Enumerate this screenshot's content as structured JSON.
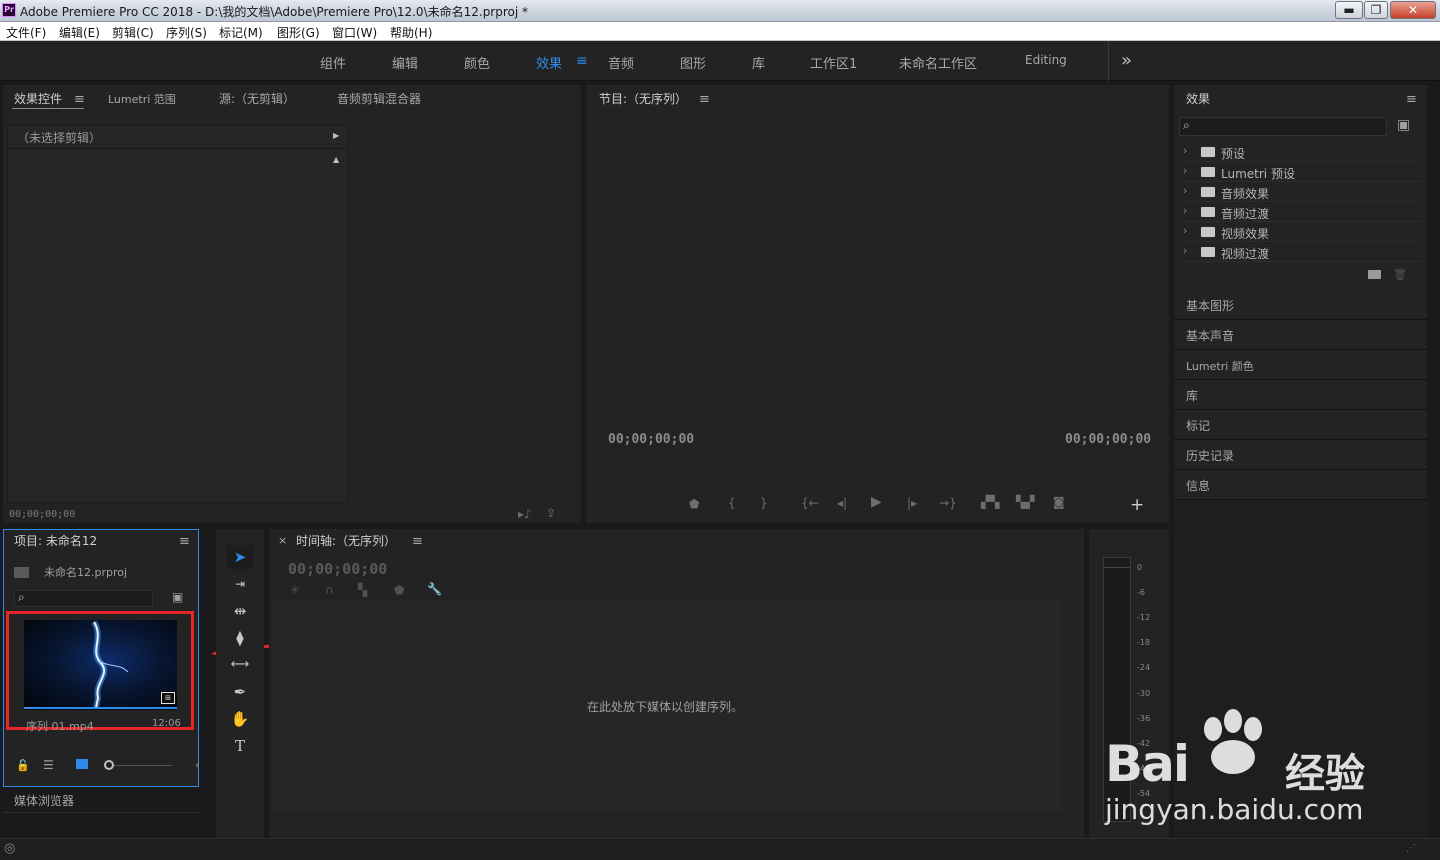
{
  "window": {
    "title": "Adobe Premiere Pro CC 2018 - D:\\我的文档\\Adobe\\Premiere Pro\\12.0\\未命名12.prproj *",
    "app_icon": "Pr",
    "minimize": "▬",
    "maximize": "❐",
    "close": "✕"
  },
  "menu": [
    "文件(F)",
    "编辑(E)",
    "剪辑(C)",
    "序列(S)",
    "标记(M)",
    "图形(G)",
    "窗口(W)",
    "帮助(H)"
  ],
  "workspaces": [
    "组件",
    "编辑",
    "颜色",
    "效果",
    "音频",
    "图形",
    "库",
    "工作区1",
    "未命名工作区",
    "Editing"
  ],
  "workspace_active": "效果",
  "workspace_overflow": "»",
  "source_panel": {
    "tabs": [
      "效果控件",
      "Lumetri 范围",
      "源:（无剪辑）",
      "音频剪辑混合器"
    ],
    "no_clip": "（未选择剪辑）",
    "timecode": "00;00;00;00"
  },
  "program_panel": {
    "title": "节目:（无序列）",
    "timecode_left": "00;00;00;00",
    "timecode_right": "00;00;00;00",
    "add": "+"
  },
  "effects_panel": {
    "title": "效果",
    "search_icon": "search-icon",
    "items": [
      "预设",
      "Lumetri 预设",
      "音频效果",
      "音频过渡",
      "视频效果",
      "视频过渡"
    ],
    "sections": [
      "基本图形",
      "基本声音",
      "Lumetri 颜色",
      "库",
      "标记",
      "历史记录",
      "信息"
    ]
  },
  "project_panel": {
    "title": "项目: 未命名12",
    "file": "未命名12.prproj",
    "clip_name": "序列 01.mp4",
    "clip_duration": "12:06",
    "media_browser": "媒体浏览器"
  },
  "timeline_panel": {
    "close": "×",
    "title": "时间轴:（无序列）",
    "timecode": "00;00;00;00",
    "empty_message": "在此处放下媒体以创建序列。"
  },
  "audio_meter": {
    "labels": [
      "0",
      "-6",
      "-12",
      "-18",
      "-24",
      "-30",
      "-36",
      "-42",
      "-48",
      "-54"
    ]
  },
  "watermark": {
    "brand": "Bai",
    "brand_cn": "经验",
    "url": "jingyan.baidu.com"
  },
  "colors": {
    "accent_blue": "#2d8ceb",
    "highlight_red": "#e8262a",
    "panel_bg": "#232323"
  }
}
